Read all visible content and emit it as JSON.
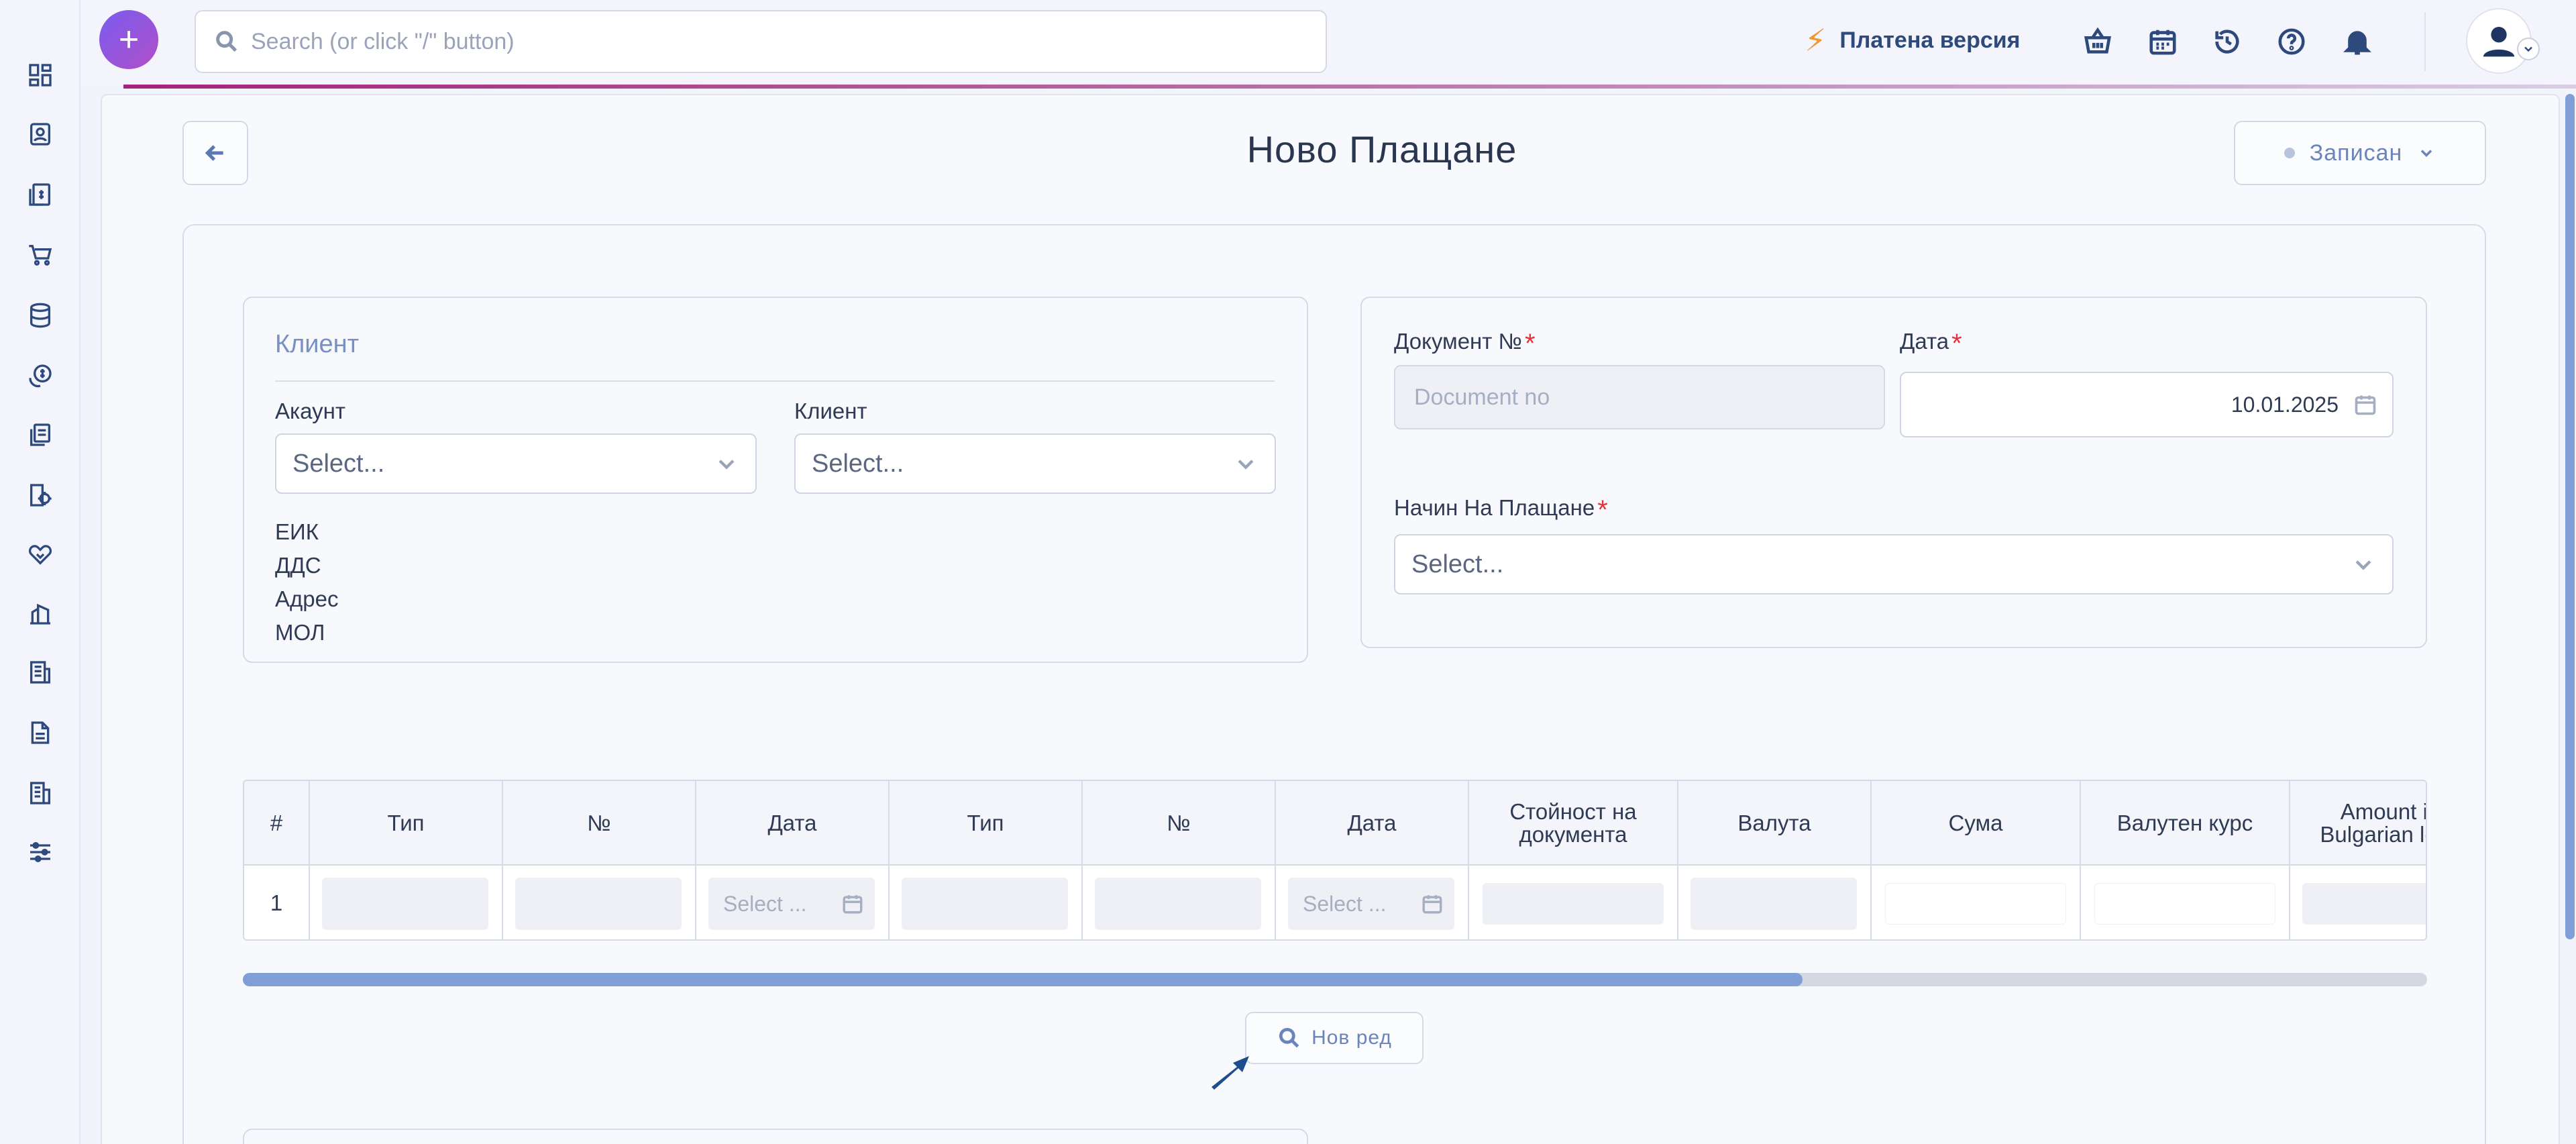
{
  "search": {
    "placeholder": "Search (or click \"/\" button)"
  },
  "header": {
    "paid_version_label": "Платена версия",
    "icons": [
      "basket-icon",
      "calendar-icon",
      "history-icon",
      "help-icon",
      "bell-icon"
    ]
  },
  "sidebar": {
    "icons": [
      "dashboard-icon",
      "contacts-icon",
      "invoices-icon",
      "cart-icon",
      "database-icon",
      "payments-icon",
      "documents-icon",
      "settings-doc-icon",
      "handshake-icon",
      "reports-icon",
      "ledger-icon",
      "file-icon",
      "buildings-icon",
      "sliders-icon"
    ]
  },
  "page": {
    "title": "Ново Плащане",
    "status_label": "Записан"
  },
  "client_section": {
    "title": "Клиент",
    "account_label": "Акаунт",
    "account_value": "Select...",
    "client_label": "Клиент",
    "client_value": "Select...",
    "info_labels": [
      "ЕИК",
      "ДДС",
      "Адрес",
      "МОЛ"
    ]
  },
  "document_section": {
    "doc_no_label": "Документ №",
    "doc_no_placeholder": "Document no",
    "date_label": "Дата",
    "date_value": "10.01.2025",
    "payment_method_label": "Начин На Плащане",
    "payment_method_value": "Select...",
    "required_mark": "*"
  },
  "table": {
    "columns": [
      "#",
      "Тип",
      "№",
      "Дата",
      "Тип",
      "№",
      "Дата",
      "Стойност на документа",
      "Валута",
      "Сума",
      "Валутен курс",
      "Amount in Bulgarian leva"
    ],
    "rows": [
      {
        "num": "1",
        "date1_placeholder": "Select ...",
        "date2_placeholder": "Select ..."
      }
    ],
    "scroll_fraction": 0.714
  },
  "actions": {
    "new_row_label": "Нов ред"
  },
  "colors": {
    "accent": "#7f9fd6",
    "brand_gradient_start": "#7a5cf0",
    "brand_gradient_end": "#b04fc8",
    "required": "#e0353c",
    "bolt": "#f0982f"
  }
}
